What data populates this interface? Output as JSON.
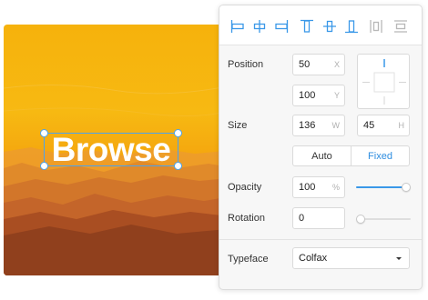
{
  "canvas": {
    "selected_text": "Browse",
    "accent": "#4aa3ef"
  },
  "inspector": {
    "align_icons": [
      "align-left-icon",
      "align-horizontal-center-icon",
      "align-right-icon",
      "align-top-icon",
      "align-vertical-center-icon",
      "align-bottom-icon",
      "distribute-horizontal-icon",
      "distribute-vertical-icon"
    ],
    "position": {
      "label": "Position",
      "x": "50",
      "x_unit": "X",
      "y": "100",
      "y_unit": "Y"
    },
    "size": {
      "label": "Size",
      "w": "136",
      "w_unit": "W",
      "h": "45",
      "h_unit": "H"
    },
    "sizing_mode": {
      "options": [
        "Auto",
        "Fixed"
      ],
      "selected": "Fixed"
    },
    "opacity": {
      "label": "Opacity",
      "value": "100",
      "unit": "%",
      "level": 1.0
    },
    "rotation": {
      "label": "Rotation",
      "value": "0",
      "level": 0.0
    },
    "typeface": {
      "label": "Typeface",
      "value": "Colfax"
    },
    "colors": {
      "accent": "#2f8ee0",
      "active_icon": "#3a98e8",
      "disabled_icon": "#b8b8b8"
    }
  }
}
